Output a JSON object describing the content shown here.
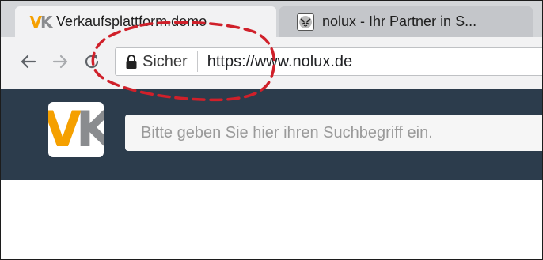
{
  "tabs": [
    {
      "title": "Verkaufsplattform.demo",
      "favicon": "vk-logo-icon",
      "active": true
    },
    {
      "title": "nolux - Ihr Partner in S...",
      "favicon": "tiger-icon",
      "active": false
    }
  ],
  "toolbar": {
    "back_icon": "back-arrow-icon",
    "forward_icon": "forward-arrow-icon",
    "reload_icon": "reload-icon"
  },
  "omnibox": {
    "secure_label": "Sicher",
    "url": "https://www.nolux.de",
    "lock_icon": "lock-icon"
  },
  "site": {
    "logo_v": "V",
    "logo_k": "K",
    "search_placeholder": "Bitte geben Sie hier ihren Suchbegriff ein."
  },
  "colors": {
    "header_bg": "#2c3c4c",
    "logo_orange": "#f5a000",
    "logo_grey": "#8a8c8f",
    "annotation_red": "#d0202a"
  }
}
